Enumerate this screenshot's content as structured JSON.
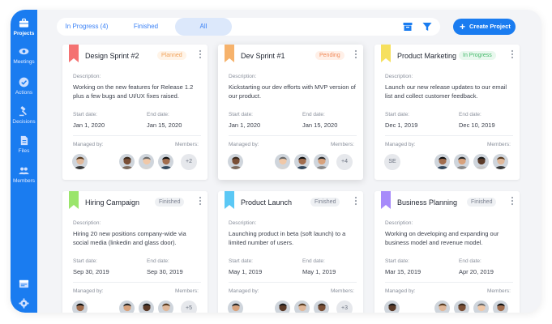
{
  "sidebar": {
    "items": [
      {
        "label": "Projects",
        "icon": "briefcase-icon",
        "active": true
      },
      {
        "label": "Meetings",
        "icon": "eye-icon",
        "active": false
      },
      {
        "label": "Actions",
        "icon": "check-circle-icon",
        "active": false
      },
      {
        "label": "Decisions",
        "icon": "gavel-icon",
        "active": false
      },
      {
        "label": "Files",
        "icon": "file-icon",
        "active": false
      },
      {
        "label": "Members",
        "icon": "members-icon",
        "active": false
      }
    ],
    "bottom_icons": [
      "browser-window-icon",
      "gear-icon"
    ]
  },
  "tabs": [
    {
      "label": "In Progress (4)",
      "selected": false
    },
    {
      "label": "Finished",
      "selected": false
    },
    {
      "label": "All",
      "selected": true
    }
  ],
  "toolbar": {
    "archive_icon": "archive-icon",
    "filter_icon": "filter-icon",
    "create_label": "Create Project"
  },
  "labels": {
    "description": "Description:",
    "start": "Start date:",
    "end": "End date:",
    "managed": "Managed by:",
    "members": "Members:"
  },
  "colors": {
    "accent": "#1a7cf0",
    "sidebar": "#1a7cf0"
  },
  "projects": [
    {
      "title": "Design Sprint #2",
      "status": "Planned",
      "flag_color": "#f47272",
      "description": "Working on the new features for Release 1.2 plus a few bugs and UI/UX fixes raised.",
      "start": "Jan 1, 2020",
      "end": "Jan 15, 2020",
      "members_more": "+2"
    },
    {
      "title": "Dev Sprint #1",
      "status": "Pending",
      "flag_color": "#f6b26b",
      "description": "Kickstarting our dev efforts with MVP version of our product.",
      "start": "Jan 1, 2020",
      "end": "Jan 15, 2020",
      "members_more": "+4"
    },
    {
      "title": "Product Marketing",
      "status": "In Progress",
      "flag_color": "#f6e05e",
      "description": "Launch our new release updates to our email list and collect customer feedback.",
      "start": "Dec 1, 2019",
      "end": "Dec 10, 2019",
      "manager_initials": "SE"
    },
    {
      "title": "Hiring Campaign",
      "status": "Finished",
      "flag_color": "#9ae56b",
      "description": "Hiring 20 new positions company-wide via social media (linkedin and glass door).",
      "start": "Sep 30, 2019",
      "end": "Sep 30, 2019",
      "members_more": "+5"
    },
    {
      "title": "Product Launch",
      "status": "Finished",
      "flag_color": "#5bc8f5",
      "description": "Launching product in beta (soft launch) to a limited number of users.",
      "start": "May 1, 2019",
      "end": "May 1, 2019",
      "members_more": "+3"
    },
    {
      "title": "Business Planning",
      "status": "Finished",
      "flag_color": "#a78bfa",
      "description": "Working on developing and expanding our business model and revenue model.",
      "start": "Mar 15, 2019",
      "end": "Apr 20, 2019"
    }
  ]
}
